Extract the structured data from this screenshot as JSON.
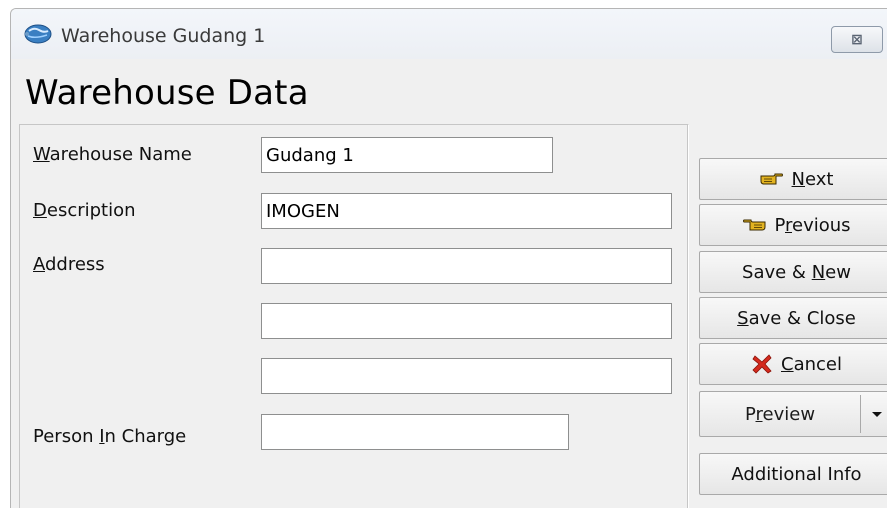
{
  "window": {
    "title": "Warehouse Gudang 1",
    "close_glyph": "⊠"
  },
  "heading": "Warehouse Data",
  "form": {
    "warehouse_name": {
      "label_key": "W",
      "label_rest": "arehouse Name",
      "value": "Gudang 1"
    },
    "description": {
      "label_key": "D",
      "label_rest": "escription",
      "value": "IMOGEN"
    },
    "address": {
      "label_key": "A",
      "label_rest": "ddress",
      "lines": [
        "",
        "",
        ""
      ]
    },
    "person_in_charge": {
      "label_pre": "Person ",
      "label_key": "I",
      "label_rest": "n Charge",
      "value": ""
    }
  },
  "buttons": {
    "next": {
      "key": "N",
      "rest": "ext",
      "icon": "pointing-hand-right-icon"
    },
    "previous": {
      "pre": "P",
      "key": "r",
      "rest": "evious",
      "icon": "pointing-hand-left-icon"
    },
    "save_new": {
      "pre": "Save & ",
      "key": "N",
      "rest": "ew"
    },
    "save_close": {
      "key": "S",
      "rest": "ave & Close"
    },
    "cancel": {
      "key": "C",
      "rest": "ancel",
      "icon": "red-x-icon"
    },
    "preview": {
      "pre": "P",
      "key": "r",
      "rest": "eview"
    },
    "additional_info": "Additional Info"
  },
  "colors": {
    "cancel_icon": "#d42a1e",
    "hand_icon": "#e2b321"
  }
}
